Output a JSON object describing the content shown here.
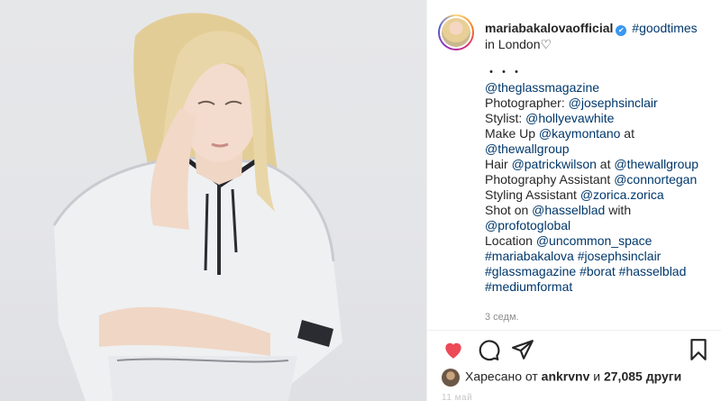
{
  "post": {
    "username": "mariabakalovaofficial",
    "verified_icon": "verified-badge-icon",
    "header_tag": "#goodtimes",
    "location_text": "in London",
    "caption_lines": [
      [
        {
          "t": "・・・",
          "m": false
        }
      ],
      [
        {
          "t": "@theglassmagazine",
          "m": true
        }
      ],
      [
        {
          "t": "Photographer: ",
          "m": false
        },
        {
          "t": "@josephsinclair",
          "m": true
        }
      ],
      [
        {
          "t": "Stylist: ",
          "m": false
        },
        {
          "t": "@hollyevawhite",
          "m": true
        }
      ],
      [
        {
          "t": "Make Up ",
          "m": false
        },
        {
          "t": "@kaymontano",
          "m": true
        },
        {
          "t": " at",
          "m": false
        }
      ],
      [
        {
          "t": "@thewallgroup",
          "m": true
        }
      ],
      [
        {
          "t": "Hair ",
          "m": false
        },
        {
          "t": "@patrickwilson",
          "m": true
        },
        {
          "t": " at ",
          "m": false
        },
        {
          "t": "@thewallgroup",
          "m": true
        }
      ],
      [
        {
          "t": "Photography Assistant ",
          "m": false
        },
        {
          "t": "@connortegan",
          "m": true
        }
      ],
      [
        {
          "t": "Styling Assistant ",
          "m": false
        },
        {
          "t": "@zorica.zorica",
          "m": true
        }
      ],
      [
        {
          "t": "Shot on ",
          "m": false
        },
        {
          "t": "@hasselblad",
          "m": true
        },
        {
          "t": " with",
          "m": false
        }
      ],
      [
        {
          "t": "@profotoglobal",
          "m": true
        }
      ],
      [
        {
          "t": "Location ",
          "m": false
        },
        {
          "t": "@uncommon_space",
          "m": true
        }
      ],
      [
        {
          "t": "#mariabakalova",
          "m": true
        },
        {
          "t": " ",
          "m": false
        },
        {
          "t": "#josephsinclair",
          "m": true
        }
      ],
      [
        {
          "t": "#glassmagazine",
          "m": true
        },
        {
          "t": " ",
          "m": false
        },
        {
          "t": "#borat",
          "m": true
        },
        {
          "t": " ",
          "m": false
        },
        {
          "t": "#hasselblad",
          "m": true
        }
      ],
      [
        {
          "t": "#mediumformat",
          "m": true
        }
      ]
    ],
    "time_ago": "3 седм."
  },
  "actions": {
    "like_icon": "heart-filled-icon",
    "comment_icon": "comment-icon",
    "share_icon": "paper-plane-icon",
    "save_icon": "bookmark-icon"
  },
  "likes": {
    "prefix": "Харесано от ",
    "user": "ankrvnv",
    "middle": " и ",
    "count": "27,085 други"
  },
  "date": "11 май",
  "colors": {
    "like_red": "#ed4956",
    "link_blue": "#00376b",
    "verified_blue": "#3897f0",
    "muted": "#8e8e8e"
  }
}
